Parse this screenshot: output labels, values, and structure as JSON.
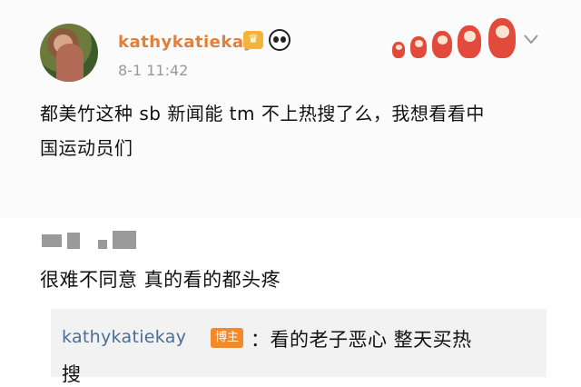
{
  "post": {
    "username": "kathykatiekay",
    "timestamp": "8-1 11:42",
    "text_line1": "都美竹这种 sb 新闻能 tm 不上热搜了么，我想看看中",
    "text_line2": "国运动员们"
  },
  "reply": {
    "text": "很难不同意 真的看的都头疼",
    "quote": {
      "username": "kathykatiekay",
      "badge": "博主",
      "text": "：看的老子恶心 整天买热",
      "text_line2": "搜"
    }
  },
  "icons": {
    "crown": "crown-badge-icon",
    "panda": "panda-badge-icon",
    "dolls": "matryoshka-dolls-icon",
    "more": "chevron-down-icon"
  },
  "colors": {
    "username": "#e0803a",
    "quote_username": "#4a6e98",
    "author_badge": "#f08a2c"
  }
}
